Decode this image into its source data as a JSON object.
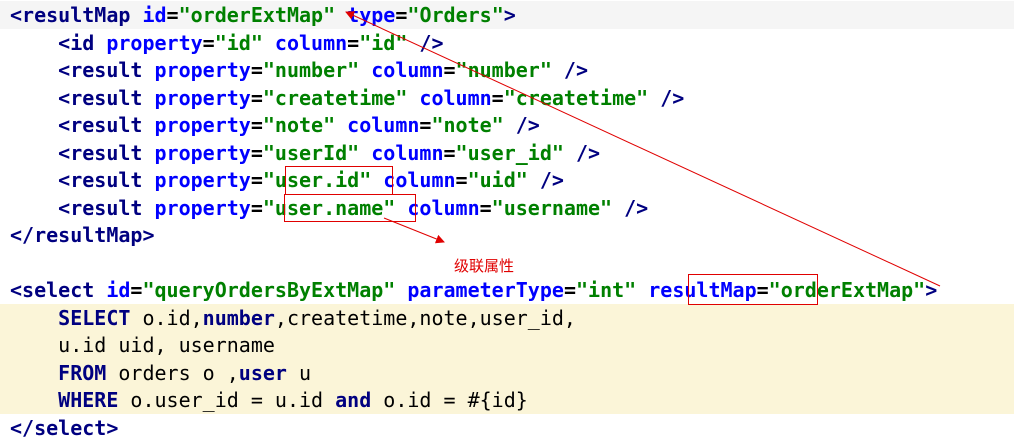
{
  "colors": {
    "tag": "#000080",
    "attribute": "#0000ff",
    "string": "#008000",
    "annotation": "#e00000",
    "highlight": "#fbf5d8"
  },
  "annotation_label": "级联属性",
  "lines": [
    [
      {
        "t": "<resultMap ",
        "c": "tag"
      },
      {
        "t": "id",
        "c": "attr"
      },
      {
        "t": "=",
        "c": "punc"
      },
      {
        "t": "\"orderExtMap\"",
        "c": "val"
      },
      {
        "t": " ",
        "c": "punc"
      },
      {
        "t": "type",
        "c": "attr"
      },
      {
        "t": "=",
        "c": "punc"
      },
      {
        "t": "\"Orders\"",
        "c": "val"
      },
      {
        "t": ">",
        "c": "tag"
      }
    ],
    [
      {
        "t": "    <id ",
        "c": "tag"
      },
      {
        "t": "property",
        "c": "attr"
      },
      {
        "t": "=",
        "c": "punc"
      },
      {
        "t": "\"id\"",
        "c": "val"
      },
      {
        "t": " ",
        "c": "punc"
      },
      {
        "t": "column",
        "c": "attr"
      },
      {
        "t": "=",
        "c": "punc"
      },
      {
        "t": "\"id\"",
        "c": "val"
      },
      {
        "t": " />",
        "c": "tag"
      }
    ],
    [
      {
        "t": "    <result ",
        "c": "tag"
      },
      {
        "t": "property",
        "c": "attr"
      },
      {
        "t": "=",
        "c": "punc"
      },
      {
        "t": "\"number\"",
        "c": "val"
      },
      {
        "t": " ",
        "c": "punc"
      },
      {
        "t": "column",
        "c": "attr"
      },
      {
        "t": "=",
        "c": "punc"
      },
      {
        "t": "\"number\"",
        "c": "val"
      },
      {
        "t": " />",
        "c": "tag"
      }
    ],
    [
      {
        "t": "    <result ",
        "c": "tag"
      },
      {
        "t": "property",
        "c": "attr"
      },
      {
        "t": "=",
        "c": "punc"
      },
      {
        "t": "\"createtime\"",
        "c": "val"
      },
      {
        "t": " ",
        "c": "punc"
      },
      {
        "t": "column",
        "c": "attr"
      },
      {
        "t": "=",
        "c": "punc"
      },
      {
        "t": "\"createtime\"",
        "c": "val"
      },
      {
        "t": " />",
        "c": "tag"
      }
    ],
    [
      {
        "t": "    <result ",
        "c": "tag"
      },
      {
        "t": "property",
        "c": "attr"
      },
      {
        "t": "=",
        "c": "punc"
      },
      {
        "t": "\"note\"",
        "c": "val"
      },
      {
        "t": " ",
        "c": "punc"
      },
      {
        "t": "column",
        "c": "attr"
      },
      {
        "t": "=",
        "c": "punc"
      },
      {
        "t": "\"note\"",
        "c": "val"
      },
      {
        "t": " />",
        "c": "tag"
      }
    ],
    [
      {
        "t": "    <result ",
        "c": "tag"
      },
      {
        "t": "property",
        "c": "attr"
      },
      {
        "t": "=",
        "c": "punc"
      },
      {
        "t": "\"userId\"",
        "c": "val"
      },
      {
        "t": " ",
        "c": "punc"
      },
      {
        "t": "column",
        "c": "attr"
      },
      {
        "t": "=",
        "c": "punc"
      },
      {
        "t": "\"user_id\"",
        "c": "val"
      },
      {
        "t": " />",
        "c": "tag"
      }
    ],
    [
      {
        "t": "    <result ",
        "c": "tag"
      },
      {
        "t": "property",
        "c": "attr"
      },
      {
        "t": "=",
        "c": "punc"
      },
      {
        "t": "\"user.id\"",
        "c": "val"
      },
      {
        "t": " ",
        "c": "punc"
      },
      {
        "t": "column",
        "c": "attr"
      },
      {
        "t": "=",
        "c": "punc"
      },
      {
        "t": "\"uid\"",
        "c": "val"
      },
      {
        "t": " />",
        "c": "tag"
      }
    ],
    [
      {
        "t": "    <result ",
        "c": "tag"
      },
      {
        "t": "property",
        "c": "attr"
      },
      {
        "t": "=",
        "c": "punc"
      },
      {
        "t": "\"user.name\"",
        "c": "val"
      },
      {
        "t": " ",
        "c": "punc"
      },
      {
        "t": "column",
        "c": "attr"
      },
      {
        "t": "=",
        "c": "punc"
      },
      {
        "t": "\"username\"",
        "c": "val"
      },
      {
        "t": " />",
        "c": "tag"
      }
    ],
    [
      {
        "t": "</resultMap>",
        "c": "tag"
      }
    ],
    [],
    [
      {
        "t": "<select ",
        "c": "tag"
      },
      {
        "t": "id",
        "c": "attr"
      },
      {
        "t": "=",
        "c": "punc"
      },
      {
        "t": "\"queryOrdersByExtMap\"",
        "c": "val"
      },
      {
        "t": " ",
        "c": "punc"
      },
      {
        "t": "parameterType",
        "c": "attr"
      },
      {
        "t": "=",
        "c": "punc"
      },
      {
        "t": "\"int\"",
        "c": "val"
      },
      {
        "t": " ",
        "c": "punc"
      },
      {
        "t": "resultMap",
        "c": "attr"
      },
      {
        "t": "=",
        "c": "punc"
      },
      {
        "t": "\"orderExtMap\"",
        "c": "val"
      },
      {
        "t": ">",
        "c": "tag"
      }
    ],
    [
      {
        "t": "    SELECT ",
        "c": "kw"
      },
      {
        "t": "o.id,",
        "c": "txt"
      },
      {
        "t": "number",
        "c": "kw"
      },
      {
        "t": ",createtime,note,user_id,",
        "c": "txt"
      }
    ],
    [
      {
        "t": "    u.id uid, username",
        "c": "txt"
      }
    ],
    [
      {
        "t": "    FROM ",
        "c": "kw"
      },
      {
        "t": "orders o ,",
        "c": "txt"
      },
      {
        "t": "user",
        "c": "kw"
      },
      {
        "t": " u",
        "c": "txt"
      }
    ],
    [
      {
        "t": "    WHERE ",
        "c": "kw"
      },
      {
        "t": "o.user_id = u.id ",
        "c": "txt"
      },
      {
        "t": "and",
        "c": "kw"
      },
      {
        "t": " o.id = #{id}",
        "c": "txt"
      }
    ],
    [
      {
        "t": "</select>",
        "c": "tag"
      }
    ]
  ]
}
